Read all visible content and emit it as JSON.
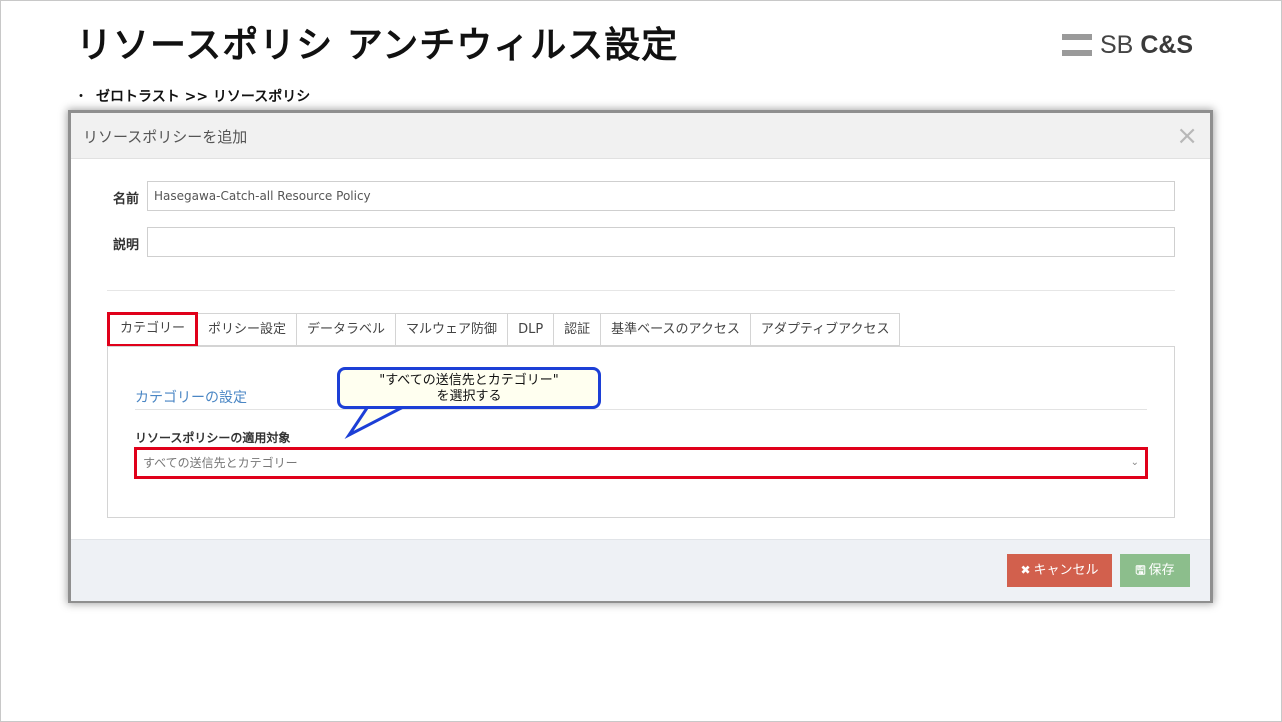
{
  "slide": {
    "title": "リソースポリシ アンチウィルス設定",
    "logo": {
      "sb": "SB",
      "cs": "C&S"
    },
    "bullet_dot": "・",
    "breadcrumb": "ゼロトラスト >> リソースポリシ"
  },
  "modal": {
    "title": "リソースポリシーを追加",
    "close": "×",
    "name_label": "名前",
    "name_value": "Hasegawa-Catch-all Resource Policy",
    "desc_label": "説明",
    "desc_value": "",
    "tabs": [
      {
        "label": "カテゴリー",
        "active": true
      },
      {
        "label": "ポリシー設定"
      },
      {
        "label": "データラベル"
      },
      {
        "label": "マルウェア防御"
      },
      {
        "label": "DLP"
      },
      {
        "label": "認証"
      },
      {
        "label": "基準ベースのアクセス"
      },
      {
        "label": "アダプティブアクセス"
      }
    ],
    "category_section_title": "カテゴリーの設定",
    "apply_label": "リソースポリシーの適用対象",
    "apply_value": "すべての送信先とカテゴリー",
    "callout_line1": "\"すべての送信先とカテゴリー\"",
    "callout_line2": "を選択する",
    "cancel_icon": "✖",
    "cancel_label": "キャンセル",
    "save_icon": "🖫",
    "save_label": "保存"
  },
  "colors": {
    "highlight": "#e0001a",
    "callout_border": "#1c3fd6",
    "section_title": "#4a86c4",
    "cancel_button": "#d2604d",
    "save_button": "#8cbe8c"
  }
}
